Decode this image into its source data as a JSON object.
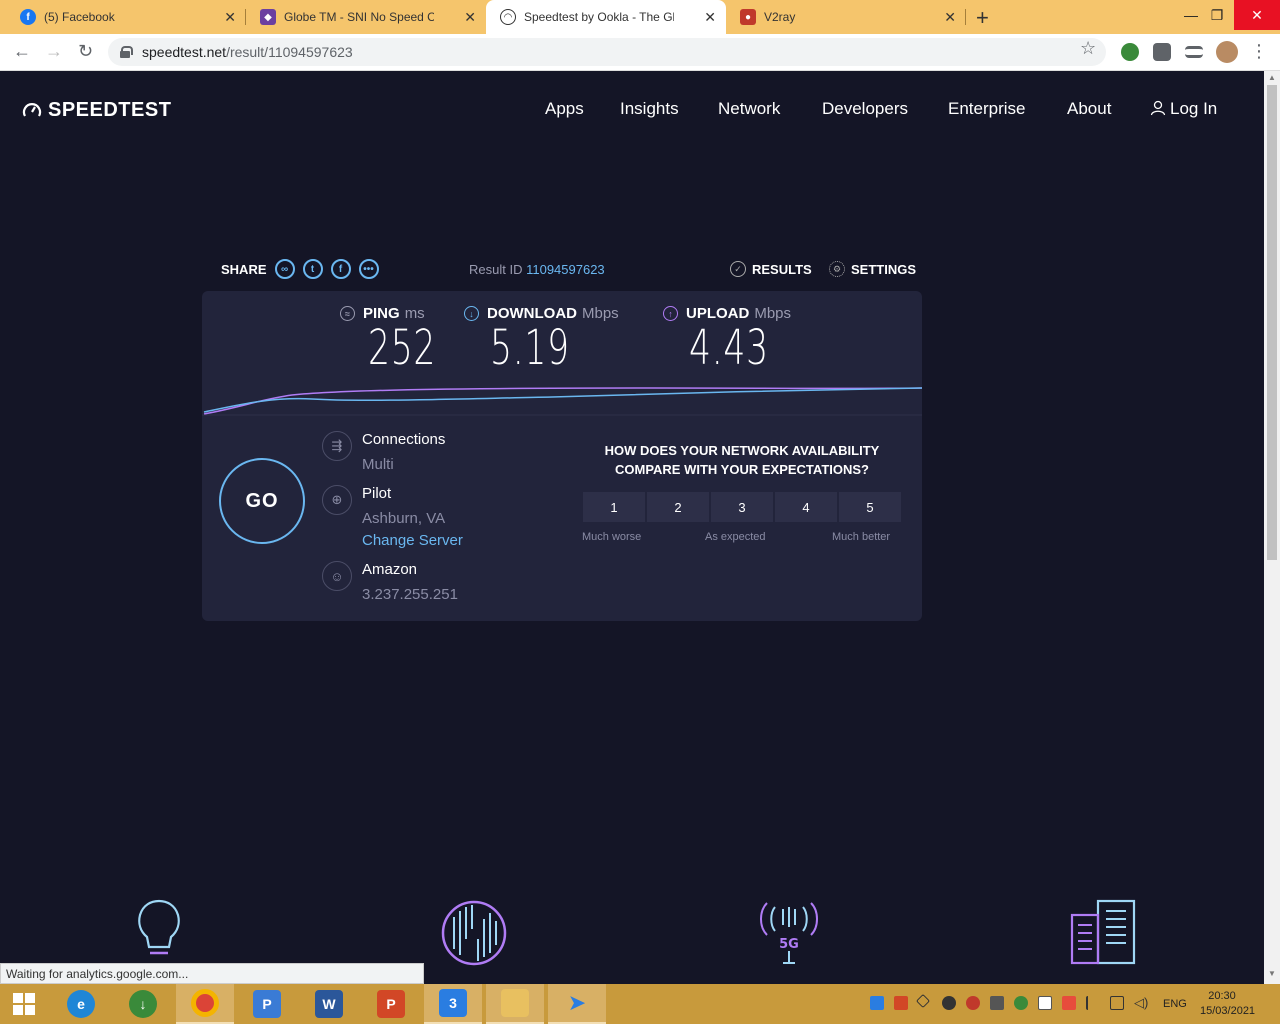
{
  "browser": {
    "tabs": [
      {
        "title": "(5) Facebook",
        "favicon": "facebook-icon",
        "color": "#1877f2"
      },
      {
        "title": "Globe TM - SNI No Speed Cap! C",
        "favicon": "globe-icon",
        "color": "#6b3fa0"
      },
      {
        "title": "Speedtest by Ookla - The Global",
        "favicon": "speedtest-icon",
        "color": "#141526"
      },
      {
        "title": "V2ray",
        "favicon": "v2ray-icon",
        "color": "#c0392b"
      }
    ],
    "url_host": "speedtest.net",
    "url_path": "/result/11094597623"
  },
  "site": {
    "logo": "SPEEDTEST",
    "nav": [
      "Apps",
      "Insights",
      "Network",
      "Developers",
      "Enterprise",
      "About",
      "Log In"
    ]
  },
  "result": {
    "share_label": "SHARE",
    "result_id_label": "Result ID",
    "result_id": "11094597623",
    "results_label": "RESULTS",
    "settings_label": "SETTINGS",
    "ping": {
      "label": "PING",
      "unit": "ms",
      "value": "252"
    },
    "download": {
      "label": "DOWNLOAD",
      "unit": "Mbps",
      "value": "5.19"
    },
    "upload": {
      "label": "UPLOAD",
      "unit": "Mbps",
      "value": "4.43"
    },
    "go_label": "GO",
    "connections": {
      "label": "Connections",
      "value": "Multi"
    },
    "server": {
      "label": "Pilot",
      "location": "Ashburn, VA",
      "change": "Change Server"
    },
    "isp": {
      "label": "Amazon",
      "ip": "3.237.255.251"
    },
    "survey": {
      "question": "HOW DOES YOUR NETWORK AVAILABILITY COMPARE WITH YOUR EXPECTATIONS?",
      "options": [
        "1",
        "2",
        "3",
        "4",
        "5"
      ],
      "low": "Much worse",
      "mid": "As expected",
      "high": "Much better"
    }
  },
  "status_text": "Waiting for analytics.google.com...",
  "taskbar": {
    "lang": "ENG",
    "time": "20:30",
    "date": "15/03/2021"
  },
  "colors": {
    "accent": "#6ab7f0",
    "download": "#6ab7f0",
    "upload": "#b07cf5",
    "background": "#141526",
    "card": "#22243b"
  }
}
